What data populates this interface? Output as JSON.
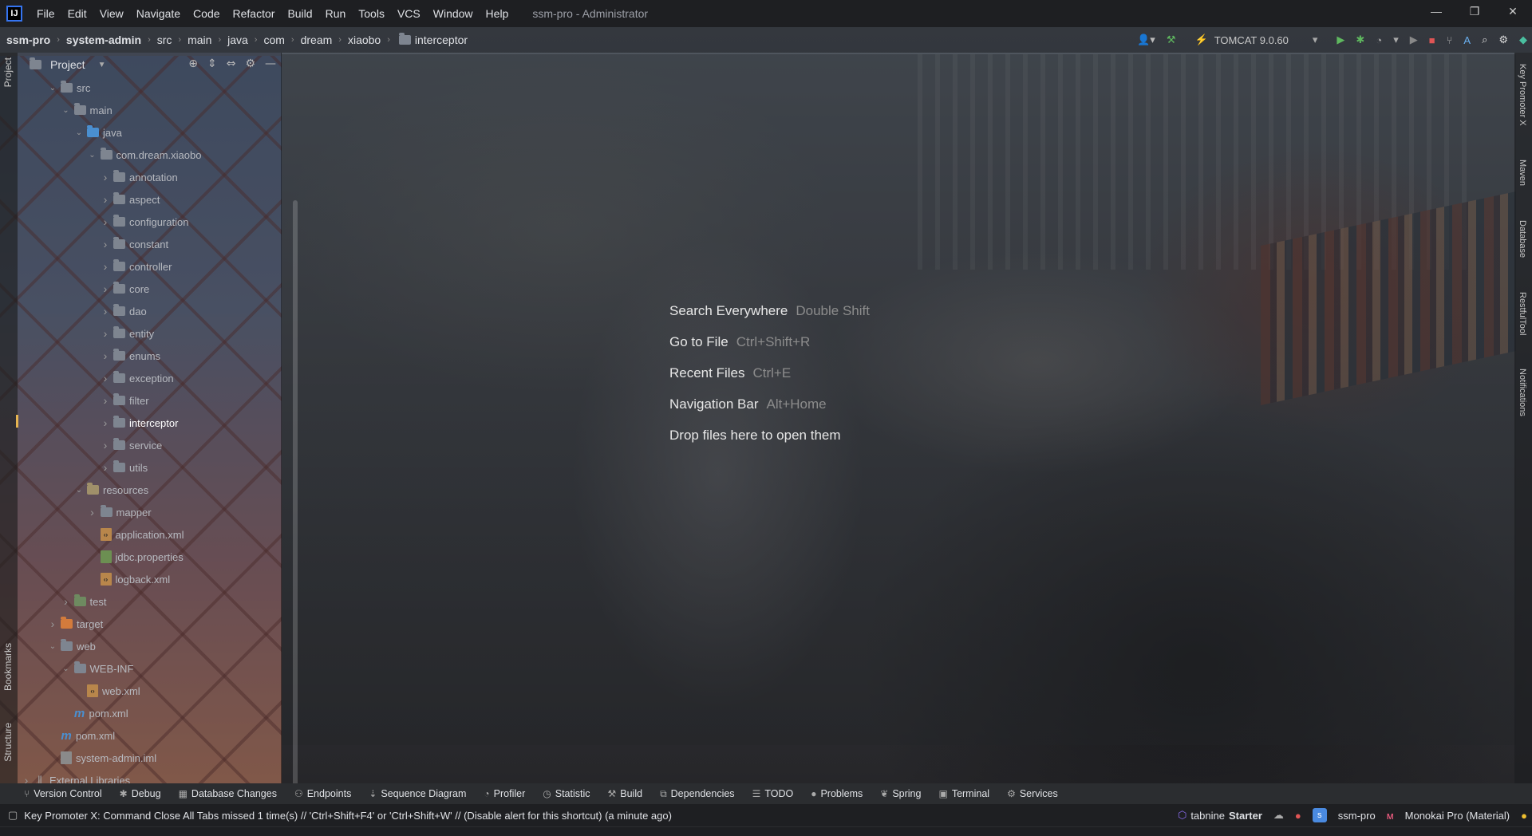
{
  "app": {
    "logo": "IJ",
    "window_title": "ssm-pro - Administrator"
  },
  "menu": [
    "File",
    "Edit",
    "View",
    "Navigate",
    "Code",
    "Refactor",
    "Build",
    "Run",
    "Tools",
    "VCS",
    "Window",
    "Help"
  ],
  "window_controls": {
    "minimize": "—",
    "restore": "❐",
    "close": "✕"
  },
  "breadcrumbs": [
    "ssm-pro",
    "system-admin",
    "src",
    "main",
    "java",
    "com",
    "dream",
    "xiaobo",
    "interceptor"
  ],
  "run_config": {
    "label": "TOMCAT 9.0.60"
  },
  "project_panel": {
    "title": "Project"
  },
  "tree": [
    {
      "label": "src",
      "depth": 2,
      "type": "plain",
      "open": true
    },
    {
      "label": "main",
      "depth": 3,
      "type": "plain",
      "open": true
    },
    {
      "label": "java",
      "depth": 4,
      "type": "src",
      "open": true
    },
    {
      "label": "com.dream.xiaobo",
      "depth": 5,
      "type": "plain",
      "open": true
    },
    {
      "label": "annotation",
      "depth": 6,
      "type": "plain",
      "open": false
    },
    {
      "label": "aspect",
      "depth": 6,
      "type": "plain",
      "open": false
    },
    {
      "label": "configuration",
      "depth": 6,
      "type": "plain",
      "open": false
    },
    {
      "label": "constant",
      "depth": 6,
      "type": "plain",
      "open": false
    },
    {
      "label": "controller",
      "depth": 6,
      "type": "plain",
      "open": false
    },
    {
      "label": "core",
      "depth": 6,
      "type": "plain",
      "open": false
    },
    {
      "label": "dao",
      "depth": 6,
      "type": "plain",
      "open": false
    },
    {
      "label": "entity",
      "depth": 6,
      "type": "plain",
      "open": false
    },
    {
      "label": "enums",
      "depth": 6,
      "type": "plain",
      "open": false
    },
    {
      "label": "exception",
      "depth": 6,
      "type": "plain",
      "open": false
    },
    {
      "label": "filter",
      "depth": 6,
      "type": "plain",
      "open": false
    },
    {
      "label": "interceptor",
      "depth": 6,
      "type": "plain",
      "open": false,
      "selected": true
    },
    {
      "label": "service",
      "depth": 6,
      "type": "plain",
      "open": false
    },
    {
      "label": "utils",
      "depth": 6,
      "type": "plain",
      "open": false
    },
    {
      "label": "resources",
      "depth": 4,
      "type": "res",
      "open": true
    },
    {
      "label": "mapper",
      "depth": 5,
      "type": "plain",
      "open": false
    },
    {
      "label": "application.xml",
      "depth": 5,
      "type": "xml",
      "file": true
    },
    {
      "label": "jdbc.properties",
      "depth": 5,
      "type": "prop",
      "file": true
    },
    {
      "label": "logback.xml",
      "depth": 5,
      "type": "xml",
      "file": true
    },
    {
      "label": "test",
      "depth": 3,
      "type": "test",
      "open": false
    },
    {
      "label": "target",
      "depth": 2,
      "type": "target",
      "open": false
    },
    {
      "label": "web",
      "depth": 2,
      "type": "plain",
      "open": true
    },
    {
      "label": "WEB-INF",
      "depth": 3,
      "type": "plain",
      "open": true
    },
    {
      "label": "web.xml",
      "depth": 4,
      "type": "xml",
      "file": true
    },
    {
      "label": "pom.xml",
      "depth": 3,
      "type": "maven",
      "file": true
    },
    {
      "label": "pom.xml",
      "depth": 2,
      "type": "maven",
      "file": true
    },
    {
      "label": "system-admin.iml",
      "depth": 2,
      "type": "iml",
      "file": true
    },
    {
      "label": "External Libraries",
      "depth": 0,
      "type": "lib",
      "open": false
    }
  ],
  "editor_hints": [
    {
      "action": "Search Everywhere",
      "keys": "Double Shift"
    },
    {
      "action": "Go to File",
      "keys": "Ctrl+Shift+R"
    },
    {
      "action": "Recent Files",
      "keys": "Ctrl+E"
    },
    {
      "action": "Navigation Bar",
      "keys": "Alt+Home"
    },
    {
      "action": "Drop files here to open them",
      "keys": ""
    }
  ],
  "left_tool_labels": {
    "project": "Project",
    "bookmarks": "Bookmarks",
    "structure": "Structure"
  },
  "right_tool_labels": [
    "Key Promoter X",
    "Maven",
    "Database",
    "RestfulTool",
    "Notifications"
  ],
  "bottom_tabs": [
    {
      "icon": "⑂",
      "label": "Version Control"
    },
    {
      "icon": "✱",
      "label": "Debug"
    },
    {
      "icon": "▦",
      "label": "Database Changes"
    },
    {
      "icon": "⚇",
      "label": "Endpoints"
    },
    {
      "icon": "⇣",
      "label": "Sequence Diagram"
    },
    {
      "icon": "◔",
      "label": "Profiler"
    },
    {
      "icon": "◷",
      "label": "Statistic"
    },
    {
      "icon": "⚒",
      "label": "Build"
    },
    {
      "icon": "⧉",
      "label": "Dependencies"
    },
    {
      "icon": "☰",
      "label": "TODO"
    },
    {
      "icon": "●",
      "label": "Problems"
    },
    {
      "icon": "❦",
      "label": "Spring"
    },
    {
      "icon": "▣",
      "label": "Terminal"
    },
    {
      "icon": "⚙",
      "label": "Services"
    }
  ],
  "status": {
    "message": "Key Promoter X: Command Close All Tabs missed 1 time(s) // 'Ctrl+Shift+F4' or 'Ctrl+Shift+W' // (Disable alert for this shortcut) (a minute ago)",
    "tabnine_brand": "tabnine",
    "tabnine_plan": "Starter",
    "project_badge": "s",
    "project": "ssm-pro",
    "theme": "Monokai Pro (Material)"
  }
}
